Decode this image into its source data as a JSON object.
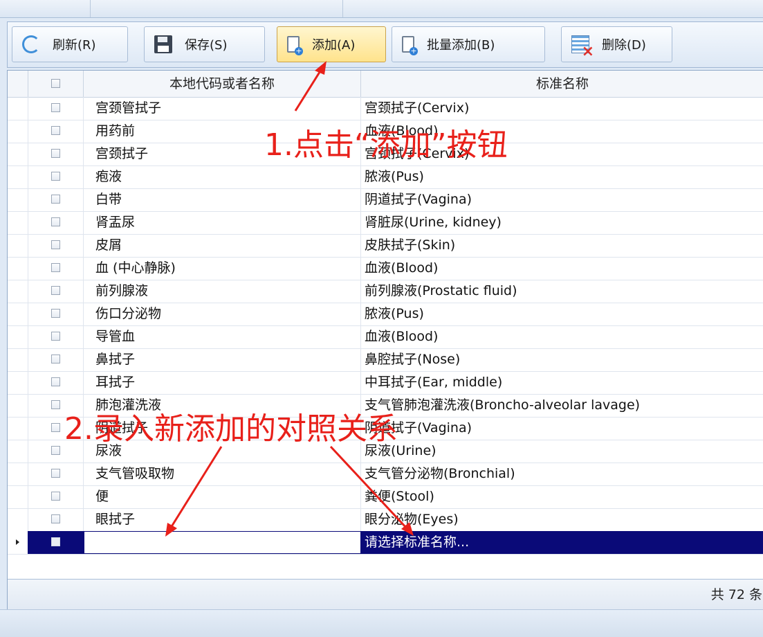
{
  "toolbar": {
    "buttons": [
      {
        "label": "刷新(R)",
        "icon": "refresh-icon"
      },
      {
        "label": "保存(S)",
        "icon": "save-icon"
      },
      {
        "label": "添加(A)",
        "icon": "add-document-icon"
      },
      {
        "label": "批量添加(B)",
        "icon": "batch-add-document-icon"
      },
      {
        "label": "删除(D)",
        "icon": "delete-table-icon"
      }
    ]
  },
  "grid": {
    "columns": {
      "local": "本地代码或者名称",
      "standard": "标准名称"
    },
    "rows": [
      {
        "local": "宫颈管拭子",
        "standard": "宫颈拭子(Cervix)"
      },
      {
        "local": "用药前",
        "standard": "血液(Blood)"
      },
      {
        "local": "宫颈拭子",
        "standard": "宫颈拭子(Cervix)"
      },
      {
        "local": "疱液",
        "standard": "脓液(Pus)"
      },
      {
        "local": "白带",
        "standard": "阴道拭子(Vagina)"
      },
      {
        "local": "肾盂尿",
        "standard": "肾脏尿(Urine, kidney)"
      },
      {
        "local": "皮屑",
        "standard": "皮肤拭子(Skin)"
      },
      {
        "local": "血 (中心静脉)",
        "standard": "血液(Blood)"
      },
      {
        "local": "前列腺液",
        "standard": "前列腺液(Prostatic fluid)"
      },
      {
        "local": "伤口分泌物",
        "standard": "脓液(Pus)"
      },
      {
        "local": "导管血",
        "standard": "血液(Blood)"
      },
      {
        "local": "鼻拭子",
        "standard": "鼻腔拭子(Nose)"
      },
      {
        "local": "耳拭子",
        "standard": "中耳拭子(Ear, middle)"
      },
      {
        "local": "肺泡灌洗液",
        "standard": "支气管肺泡灌洗液(Broncho-alveolar lavage)"
      },
      {
        "local": "阴道拭子",
        "standard": "阴道拭子(Vagina)"
      },
      {
        "local": "尿液",
        "standard": "尿液(Urine)"
      },
      {
        "local": "支气管吸取物",
        "standard": "支气管分泌物(Bronchial)"
      },
      {
        "local": "便",
        "standard": "粪便(Stool)"
      },
      {
        "local": "眼拭子",
        "standard": "眼分泌物(Eyes)"
      }
    ],
    "new_row": {
      "local": "",
      "standard": "请选择标准名称..."
    }
  },
  "footer": {
    "count": "共 72 条"
  },
  "annotations": {
    "step1": "1.点击“添加”按钮",
    "step2": "2.录入新添加的对照关系"
  },
  "colors": {
    "selected_row": "#0a0a78",
    "annotation": "#e8201a",
    "active_button": "#ffe38c"
  }
}
